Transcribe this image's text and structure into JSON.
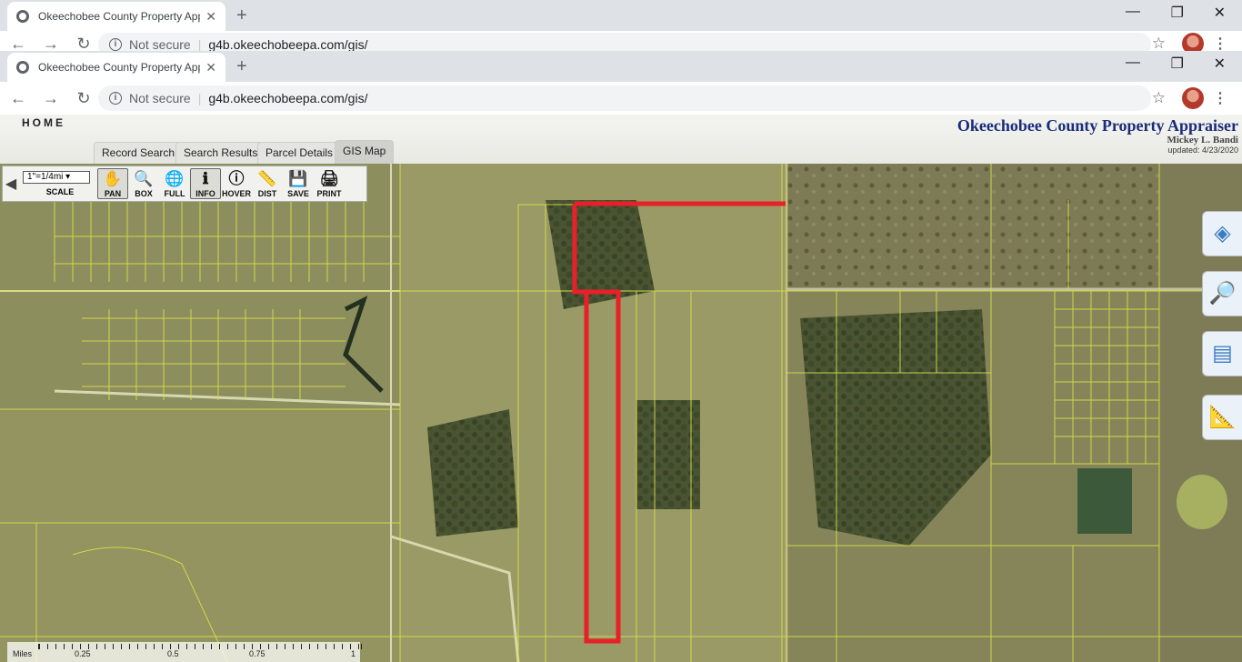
{
  "browser_back": {
    "tab_title": "Okeechobee County Property Appraiser",
    "security": "Not secure",
    "url": "g4b.okeechobeepa.com/gis/"
  },
  "browser": {
    "tab_title": "Okeechobee County Property Appraiser",
    "security": "Not secure",
    "url": "g4b.okeechobeepa.com/gis/"
  },
  "site": {
    "home": "HOME",
    "tabs": [
      "Record Search",
      "Search Results",
      "Parcel Details",
      "GIS Map"
    ],
    "active_tab": "GIS Map",
    "title": "Okeechobee County Property Appraiser",
    "owner": "Mickey L. Bandi",
    "updated": "updated: 4/23/2020"
  },
  "toolbar": {
    "scale_value": "1\"=1/4mi",
    "scale_label": "SCALE",
    "tools": [
      "PAN",
      "BOX",
      "FULL",
      "INFO",
      "HOVER",
      "DIST",
      "SAVE",
      "PRINT"
    ],
    "selected": [
      "PAN",
      "INFO"
    ]
  },
  "scalebar": {
    "unit": "Miles",
    "ticks": [
      "0.25",
      "0.5",
      "0.75",
      "1"
    ]
  },
  "icons": {
    "tab": "globe-icon",
    "layers": "layers-icon",
    "search": "search-map-icon",
    "legend": "legend-icon",
    "measure": "measure-icon"
  },
  "colors": {
    "highlight": "#e8202a",
    "parcel_lines": "#d9e04a",
    "title": "#1a2c7a"
  }
}
